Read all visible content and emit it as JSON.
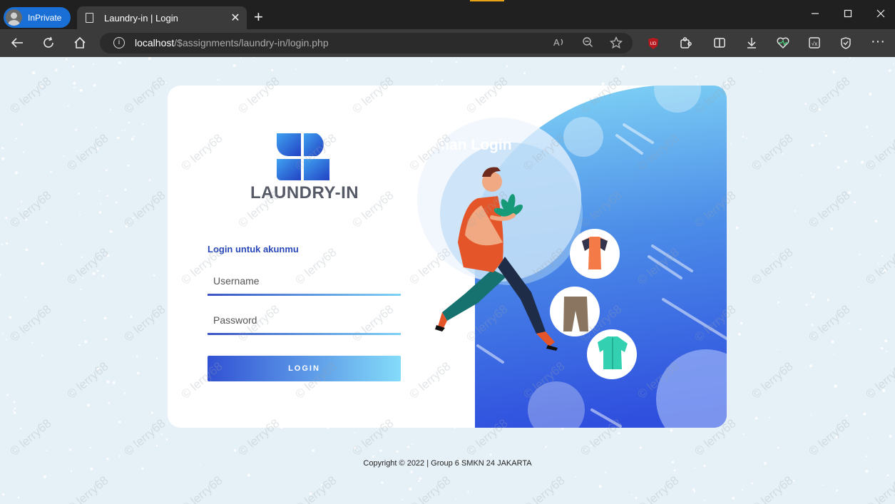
{
  "browser": {
    "inprivate_label": "InPrivate",
    "tab_title": "Laundry-in | Login",
    "url_host": "localhost",
    "url_path": "/$assignments/laundry-in/login.php"
  },
  "login": {
    "logo_text": "LAUNDRY-IN",
    "subtitle": "Login untuk akunmu",
    "username_placeholder": "Username",
    "password_placeholder": "Password",
    "button_label": "LOGIN",
    "panel_title": "Halaman Login"
  },
  "footer": {
    "copyright": "Copyright © 2022 | Group 6 SMKN 24 JAKARTA"
  },
  "colors": {
    "brand_blue": "#2847b8",
    "panel_gradient_top": "#7fd2f5",
    "panel_gradient_bottom": "#2f4fde"
  },
  "watermark": "© lerry68"
}
